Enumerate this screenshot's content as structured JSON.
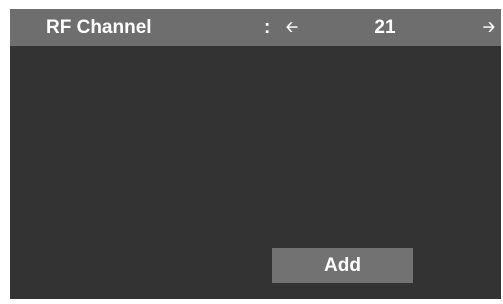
{
  "rf_channel": {
    "label": "RF Channel",
    "separator": ":",
    "value": "21",
    "left_arrow_icon": "arrow-left-icon",
    "right_arrow_icon": "arrow-right-icon"
  },
  "actions": {
    "add_label": "Add"
  },
  "colors": {
    "panel_background": "#333333",
    "header_row_background": "#6e6e6e",
    "button_background": "#727272",
    "text": "#ffffff"
  }
}
